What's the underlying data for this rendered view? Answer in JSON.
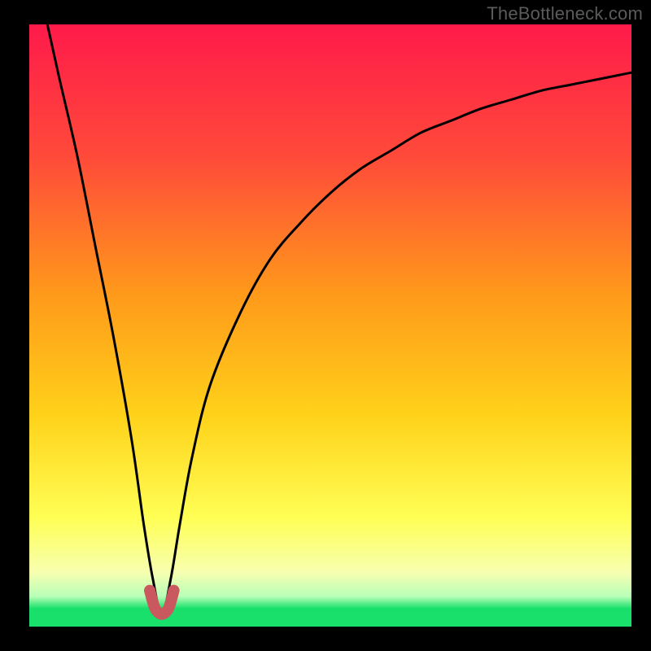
{
  "watermark": "TheBottleneck.com",
  "colors": {
    "bg_black": "#000000",
    "grad_top": "#ff1a4a",
    "grad_mid1": "#ff6a2a",
    "grad_mid2": "#ffd21a",
    "grad_low": "#ffff6a",
    "grad_pale": "#f3ffbf",
    "grad_green": "#18e06a",
    "curve_stroke": "#000000",
    "dip_stroke": "#c9595f"
  },
  "chart_data": {
    "type": "line",
    "title": "",
    "xlabel": "",
    "ylabel": "",
    "xlim": [
      0,
      100
    ],
    "ylim": [
      0,
      100
    ],
    "notes": "Bottleneck-style curve: single narrow minimum near x≈22 reaching ≈0, rising steeply on both sides. Background is a vertical gradient from red (high bottleneck) at top to green (no bottleneck) at bottom. Values estimated from pixels.",
    "series": [
      {
        "name": "bottleneck_curve",
        "x": [
          3,
          5,
          8,
          11,
          14,
          17,
          19,
          20.5,
          22,
          23.5,
          25,
          27,
          30,
          35,
          40,
          45,
          50,
          55,
          60,
          65,
          70,
          75,
          80,
          85,
          90,
          95,
          100
        ],
        "values": [
          100,
          91,
          78,
          63,
          48,
          31,
          17,
          8,
          2,
          8,
          17,
          28,
          40,
          52,
          61,
          67,
          72,
          76,
          79,
          82,
          84,
          86,
          87.5,
          89,
          90,
          91,
          92
        ]
      }
    ],
    "dip_marker": {
      "name": "optimal_range",
      "x": [
        20,
        20.8,
        21.6,
        22.4,
        23.2,
        24
      ],
      "values": [
        6,
        3.2,
        2.2,
        2.2,
        3.2,
        6
      ]
    },
    "gradient_stops": [
      {
        "pct": 0,
        "meaning": "severe",
        "color": "#ff1a4a"
      },
      {
        "pct": 35,
        "meaning": "high",
        "color": "#ff7a2a"
      },
      {
        "pct": 60,
        "meaning": "moderate",
        "color": "#ffd21a"
      },
      {
        "pct": 85,
        "meaning": "low",
        "color": "#ffff7a"
      },
      {
        "pct": 97,
        "meaning": "none",
        "color": "#18e06a"
      }
    ]
  }
}
